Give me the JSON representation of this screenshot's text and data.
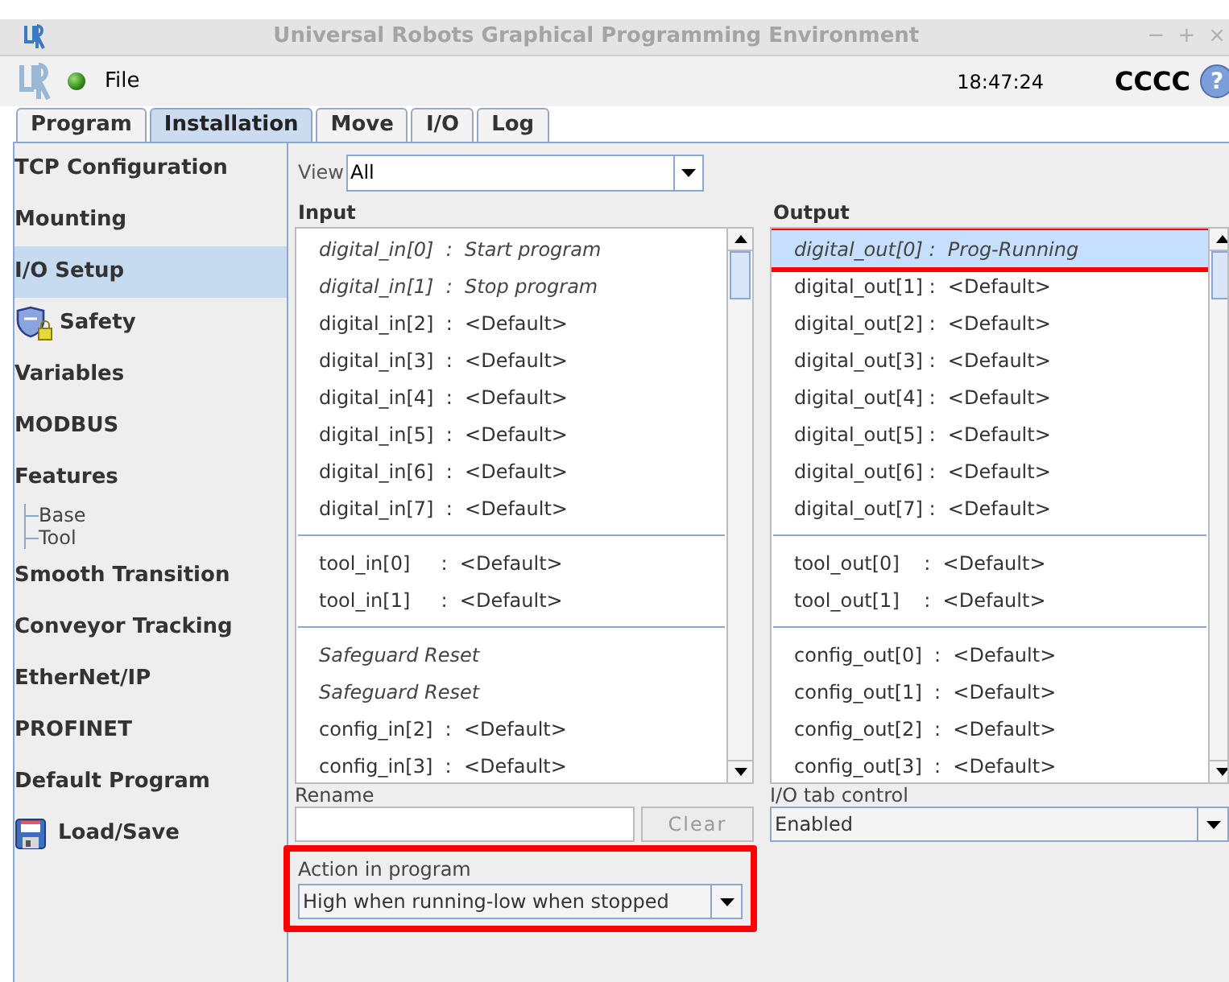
{
  "window": {
    "title": "Universal Robots Graphical Programming Environment",
    "controls": [
      "−",
      "+",
      "×"
    ]
  },
  "menu_bar": {
    "file_menu": "File",
    "time": "18:47:24",
    "robot_name": "CCCC",
    "help": "?"
  },
  "tabs": [
    {
      "label": "Program",
      "selected": false
    },
    {
      "label": "Installation",
      "selected": true
    },
    {
      "label": "Move",
      "selected": false
    },
    {
      "label": "I/O",
      "selected": false
    },
    {
      "label": "Log",
      "selected": false
    }
  ],
  "sidebar": {
    "items": [
      {
        "label": "TCP Configuration",
        "selected": false,
        "kind": "text"
      },
      {
        "label": "Mounting",
        "selected": false,
        "kind": "text"
      },
      {
        "label": "I/O Setup",
        "selected": true,
        "kind": "text"
      },
      {
        "label": "Safety",
        "selected": false,
        "kind": "shield"
      },
      {
        "label": "Variables",
        "selected": false,
        "kind": "text"
      },
      {
        "label": "MODBUS",
        "selected": false,
        "kind": "text"
      },
      {
        "label": "Features",
        "selected": false,
        "kind": "text",
        "children": [
          {
            "label": "Base"
          },
          {
            "label": "Tool"
          }
        ]
      },
      {
        "label": "Smooth Transition",
        "selected": false,
        "kind": "text"
      },
      {
        "label": "Conveyor Tracking",
        "selected": false,
        "kind": "text"
      },
      {
        "label": "EtherNet/IP",
        "selected": false,
        "kind": "text"
      },
      {
        "label": "PROFINET",
        "selected": false,
        "kind": "text"
      },
      {
        "label": "Default Program",
        "selected": false,
        "kind": "text"
      },
      {
        "label": "Load/Save",
        "selected": false,
        "kind": "disk"
      }
    ]
  },
  "view": {
    "label": "View",
    "value": "All"
  },
  "input": {
    "heading": "Input",
    "groups": [
      [
        {
          "text": "digital_in[0]  :  Start program",
          "italic": true,
          "selected": false
        },
        {
          "text": "digital_in[1]  :  Stop program",
          "italic": true,
          "selected": false
        },
        {
          "text": "digital_in[2]  :  <Default>",
          "italic": false,
          "selected": false
        },
        {
          "text": "digital_in[3]  :  <Default>",
          "italic": false,
          "selected": false
        },
        {
          "text": "digital_in[4]  :  <Default>",
          "italic": false,
          "selected": false
        },
        {
          "text": "digital_in[5]  :  <Default>",
          "italic": false,
          "selected": false
        },
        {
          "text": "digital_in[6]  :  <Default>",
          "italic": false,
          "selected": false
        },
        {
          "text": "digital_in[7]  :  <Default>",
          "italic": false,
          "selected": false
        }
      ],
      [
        {
          "text": "tool_in[0]     :  <Default>",
          "italic": false,
          "selected": false
        },
        {
          "text": "tool_in[1]     :  <Default>",
          "italic": false,
          "selected": false
        }
      ],
      [
        {
          "text": "Safeguard Reset",
          "italic": true,
          "selected": false
        },
        {
          "text": "Safeguard Reset",
          "italic": true,
          "selected": false
        },
        {
          "text": "config_in[2]  :  <Default>",
          "italic": false,
          "selected": false
        },
        {
          "text": "config_in[3]  :  <Default>",
          "italic": false,
          "selected": false
        }
      ]
    ]
  },
  "output": {
    "heading": "Output",
    "groups": [
      [
        {
          "text": "digital_out[0] :  Prog-Running",
          "italic": true,
          "selected": true,
          "highlighted": true
        },
        {
          "text": "digital_out[1] :  <Default>",
          "italic": false,
          "selected": false
        },
        {
          "text": "digital_out[2] :  <Default>",
          "italic": false,
          "selected": false
        },
        {
          "text": "digital_out[3] :  <Default>",
          "italic": false,
          "selected": false
        },
        {
          "text": "digital_out[4] :  <Default>",
          "italic": false,
          "selected": false
        },
        {
          "text": "digital_out[5] :  <Default>",
          "italic": false,
          "selected": false
        },
        {
          "text": "digital_out[6] :  <Default>",
          "italic": false,
          "selected": false
        },
        {
          "text": "digital_out[7] :  <Default>",
          "italic": false,
          "selected": false
        }
      ],
      [
        {
          "text": "tool_out[0]    :  <Default>",
          "italic": false,
          "selected": false
        },
        {
          "text": "tool_out[1]    :  <Default>",
          "italic": false,
          "selected": false
        }
      ],
      [
        {
          "text": "config_out[0]  :  <Default>",
          "italic": false,
          "selected": false
        },
        {
          "text": "config_out[1]  :  <Default>",
          "italic": false,
          "selected": false
        },
        {
          "text": "config_out[2]  :  <Default>",
          "italic": false,
          "selected": false
        },
        {
          "text": "config_out[3]  :  <Default>",
          "italic": false,
          "selected": false
        }
      ]
    ]
  },
  "rename": {
    "label": "Rename",
    "clear_button": {
      "label": "Clear",
      "disabled": true
    }
  },
  "action": {
    "label": "Action in program",
    "value": "High when running-low when stopped",
    "highlighted": true
  },
  "io_tab_control": {
    "label": "I/O tab control",
    "value": "Enabled"
  }
}
